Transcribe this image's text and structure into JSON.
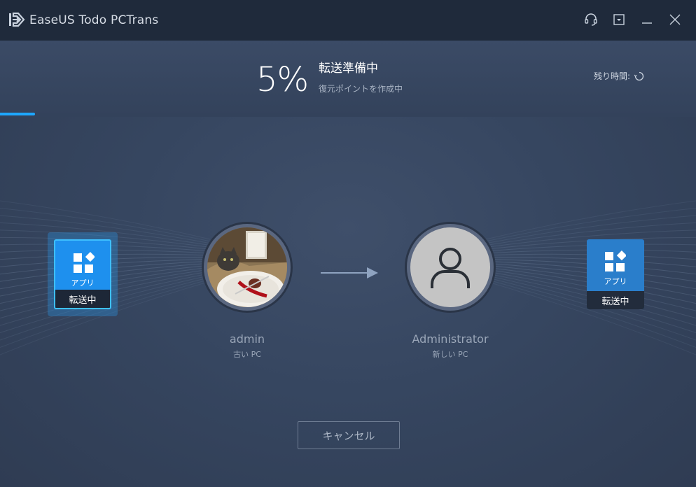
{
  "window": {
    "title": "EaseUS Todo PCTrans",
    "logo_icon": "transfer-logo-icon"
  },
  "titlebar_buttons": [
    "headset-icon",
    "menu-dropdown-icon",
    "minimize-icon",
    "close-icon"
  ],
  "progress": {
    "percent_text": "5%",
    "percent_value": 5,
    "status_title": "転送準備中",
    "status_subtitle": "復元ポイントを作成中",
    "remaining_label": "残り時間:",
    "remaining_icon": "spinner-icon"
  },
  "source": {
    "name": "admin",
    "role": "古い PC",
    "avatar_icon": "cat-photo-avatar"
  },
  "target": {
    "name": "Administrator",
    "role": "新しい PC",
    "avatar_icon": "user-silhouette-icon"
  },
  "tiles": {
    "left": {
      "label": "アプリ",
      "status": "転送中",
      "icon": "apps-grid-icon"
    },
    "right": {
      "label": "アプリ",
      "status": "転送中",
      "icon": "apps-grid-icon"
    }
  },
  "actions": {
    "cancel_label": "キャンセル"
  },
  "colors": {
    "accent": "#1ea7ff",
    "titlebar": "#1f2a3b",
    "background": "#33425a"
  }
}
